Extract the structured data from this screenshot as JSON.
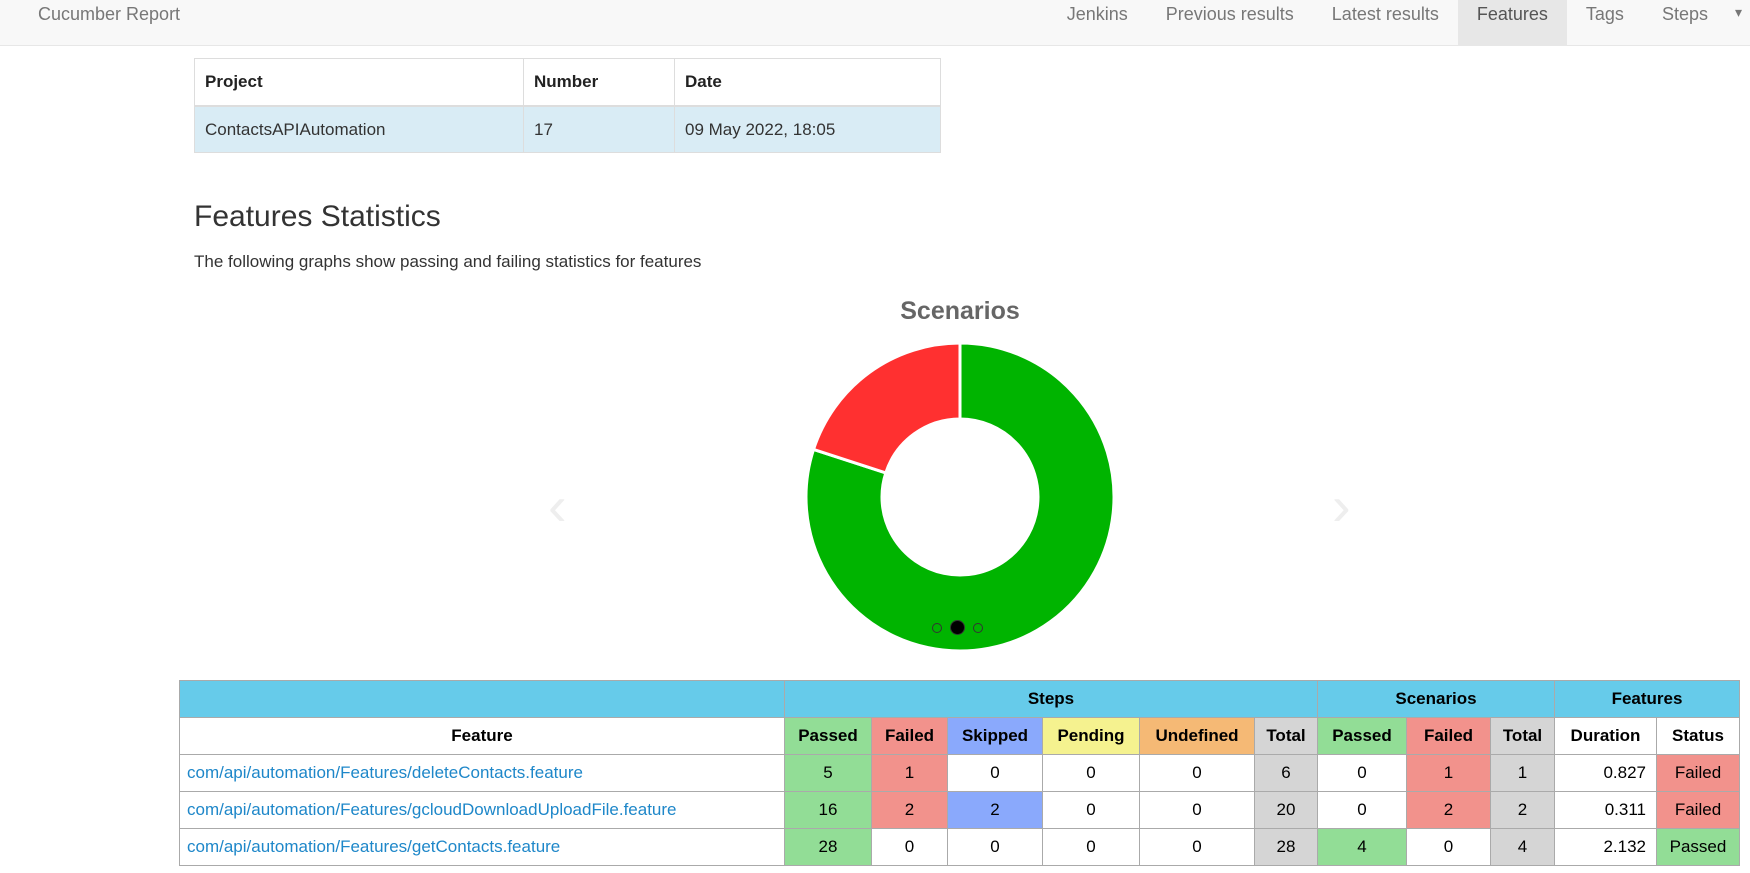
{
  "navbar": {
    "brand": "Cucumber Report",
    "items": [
      {
        "label": "Jenkins"
      },
      {
        "label": "Previous results"
      },
      {
        "label": "Latest results"
      },
      {
        "label": "Features"
      },
      {
        "label": "Tags"
      },
      {
        "label": "Steps"
      }
    ],
    "active": "Features"
  },
  "build_info": {
    "headers": [
      "Project",
      "Number",
      "Date"
    ],
    "row": [
      "ContactsAPIAutomation",
      "17",
      "09 May 2022, 18:05"
    ]
  },
  "section": {
    "title": "Features Statistics",
    "subtitle": "The following graphs show passing and failing statistics for features"
  },
  "carousel": {
    "slide_count": 3,
    "active_index": 1,
    "prev_icon": "chevron-left-icon",
    "next_icon": "chevron-right-icon"
  },
  "chart_data": {
    "type": "pie",
    "title": "Scenarios",
    "donut": true,
    "categories": [
      "Passed",
      "Failed"
    ],
    "values": [
      80,
      20
    ],
    "colors": [
      "#00b400",
      "#ff3030"
    ]
  },
  "stats_table": {
    "group_headers": [
      "",
      "Steps",
      "Scenarios",
      "Features"
    ],
    "column_headers": [
      "Feature",
      "Passed",
      "Failed",
      "Skipped",
      "Pending",
      "Undefined",
      "Total",
      "Passed",
      "Failed",
      "Total",
      "Duration",
      "Status"
    ],
    "rows": [
      {
        "feature": "com/api/automation/Features/deleteContacts.feature",
        "steps_passed": "5",
        "steps_failed": "1",
        "steps_skipped": "0",
        "steps_pending": "0",
        "steps_undefined": "0",
        "steps_total": "6",
        "scen_passed": "0",
        "scen_failed": "1",
        "scen_total": "1",
        "duration": "0.827",
        "status": "Failed"
      },
      {
        "feature": "com/api/automation/Features/gcloudDownloadUploadFile.feature",
        "steps_passed": "16",
        "steps_failed": "2",
        "steps_skipped": "2",
        "steps_pending": "0",
        "steps_undefined": "0",
        "steps_total": "20",
        "scen_passed": "0",
        "scen_failed": "2",
        "scen_total": "2",
        "duration": "0.311",
        "status": "Failed"
      },
      {
        "feature": "com/api/automation/Features/getContacts.feature",
        "steps_passed": "28",
        "steps_failed": "0",
        "steps_skipped": "0",
        "steps_pending": "0",
        "steps_undefined": "0",
        "steps_total": "28",
        "scen_passed": "4",
        "scen_failed": "0",
        "scen_total": "4",
        "duration": "2.132",
        "status": "Passed"
      }
    ]
  },
  "colors": {
    "passed": "#92dd96",
    "failed": "#f2928c",
    "skipped": "#8aa9fc",
    "pending": "#f5f28f",
    "undefined": "#f5b975",
    "total": "#d5d5d5",
    "header": "#66cbea",
    "link": "#1e87c9"
  }
}
